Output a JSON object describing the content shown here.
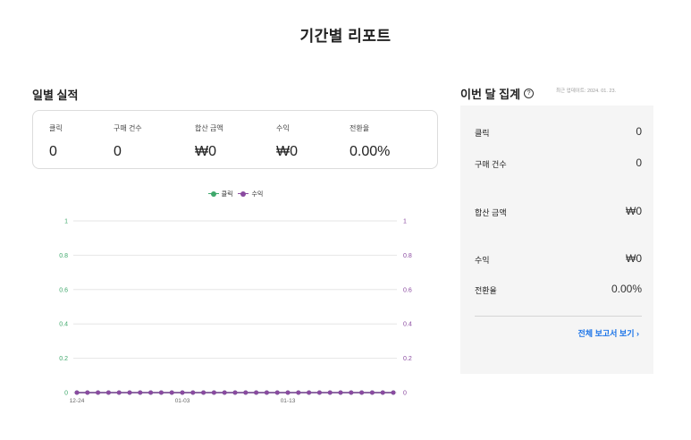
{
  "page": {
    "title": "기간별 리포트"
  },
  "daily": {
    "title": "일별 실적",
    "metrics": [
      {
        "label": "클릭",
        "value": "0"
      },
      {
        "label": "구매 건수",
        "value": "0"
      },
      {
        "label": "합산 금액",
        "value": "₩0"
      },
      {
        "label": "수익",
        "value": "₩0"
      },
      {
        "label": "전환율",
        "value": "0.00%"
      }
    ]
  },
  "chart_data": {
    "type": "line",
    "title": "",
    "xlabel": "",
    "ylabel": "",
    "legend": "top-center",
    "grid": true,
    "ylim": [
      0,
      1
    ],
    "y_ticks": [
      "0",
      "0.2",
      "0.4",
      "0.6",
      "0.8",
      "1"
    ],
    "x_tick_labels": [
      "12-24",
      "01-03",
      "01-13"
    ],
    "x": [
      "12-24",
      "12-25",
      "12-26",
      "12-27",
      "12-28",
      "12-29",
      "12-30",
      "12-31",
      "01-01",
      "01-02",
      "01-03",
      "01-04",
      "01-05",
      "01-06",
      "01-07",
      "01-08",
      "01-09",
      "01-10",
      "01-11",
      "01-12",
      "01-13",
      "01-14",
      "01-15",
      "01-16",
      "01-17",
      "01-18",
      "01-19",
      "01-20",
      "01-21",
      "01-22",
      "01-23"
    ],
    "series": [
      {
        "name": "클릭",
        "color": "#3fa86b",
        "axis": "left",
        "values": [
          0,
          0,
          0,
          0,
          0,
          0,
          0,
          0,
          0,
          0,
          0,
          0,
          0,
          0,
          0,
          0,
          0,
          0,
          0,
          0,
          0,
          0,
          0,
          0,
          0,
          0,
          0,
          0,
          0,
          0,
          0
        ]
      },
      {
        "name": "수익",
        "color": "#8a4aa0",
        "axis": "right",
        "values": [
          0,
          0,
          0,
          0,
          0,
          0,
          0,
          0,
          0,
          0,
          0,
          0,
          0,
          0,
          0,
          0,
          0,
          0,
          0,
          0,
          0,
          0,
          0,
          0,
          0,
          0,
          0,
          0,
          0,
          0,
          0
        ]
      }
    ]
  },
  "monthly": {
    "title": "이번 달 집계",
    "help_icon": "?",
    "updated": "최근 업데이트: 2024. 01. 23.",
    "rows": [
      {
        "label": "클릭",
        "value": "0"
      },
      {
        "label": "구매 건수",
        "value": "0"
      },
      {
        "label": "합산 금액",
        "value": "₩0"
      },
      {
        "label": "수익",
        "value": "₩0"
      },
      {
        "label": "전환율",
        "value": "0.00%"
      }
    ],
    "link": "전체 보고서 보기 ›"
  }
}
